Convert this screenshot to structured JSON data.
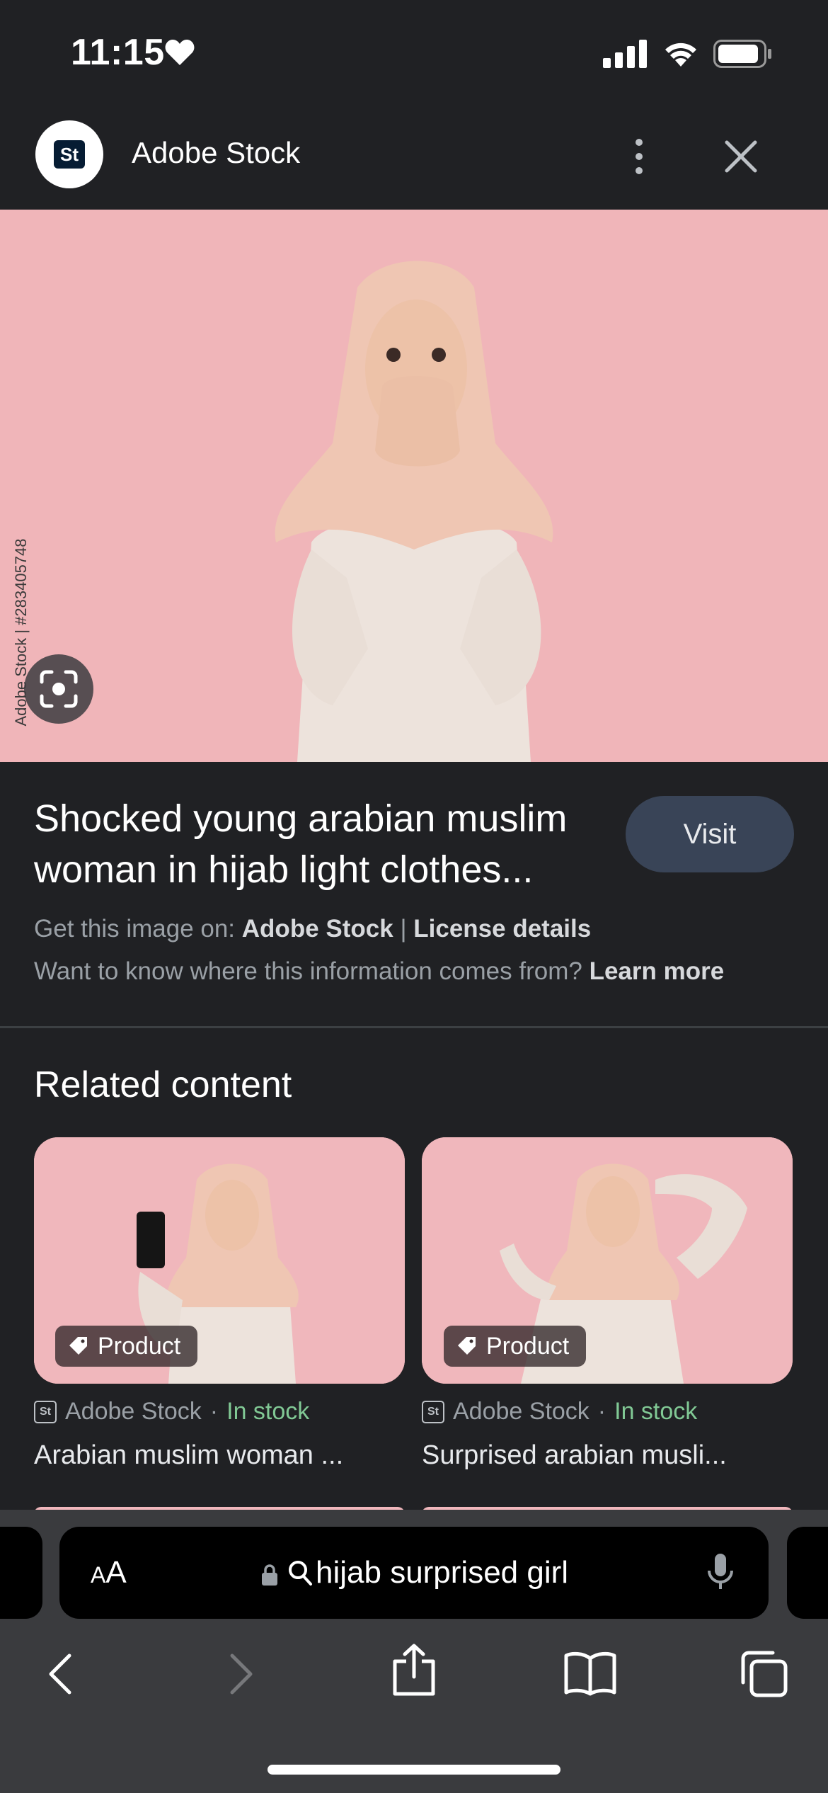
{
  "status_bar": {
    "time": "11:15"
  },
  "header": {
    "site_name": "Adobe Stock",
    "logo_text": "St"
  },
  "hero": {
    "watermark": "Adobe Stock | #283405748"
  },
  "result": {
    "title": "Shocked young arabian muslim woman in hijab light clothes...",
    "visit_label": "Visit",
    "source_prefix": "Get this image on:",
    "source_name": "Adobe Stock",
    "separator": "|",
    "license_label": "License details",
    "info_question": "Want to know where this information comes from?",
    "learn_more_label": "Learn more"
  },
  "related": {
    "heading": "Related content",
    "items": [
      {
        "badge": "Product",
        "source": "Adobe Stock",
        "stock": "In stock",
        "title": "Arabian muslim woman ...",
        "logo_text": "St"
      },
      {
        "badge": "Product",
        "source": "Adobe Stock",
        "stock": "In stock",
        "title": "Surprised arabian musli...",
        "logo_text": "St"
      }
    ]
  },
  "safari": {
    "aa_label_small": "A",
    "aa_label_large": "A",
    "address": "hijab surprised girl"
  },
  "colors": {
    "background": "#202124",
    "in_stock": "#81c995",
    "visit_button": "#394457",
    "photo_bg": "#f0b5b9"
  }
}
